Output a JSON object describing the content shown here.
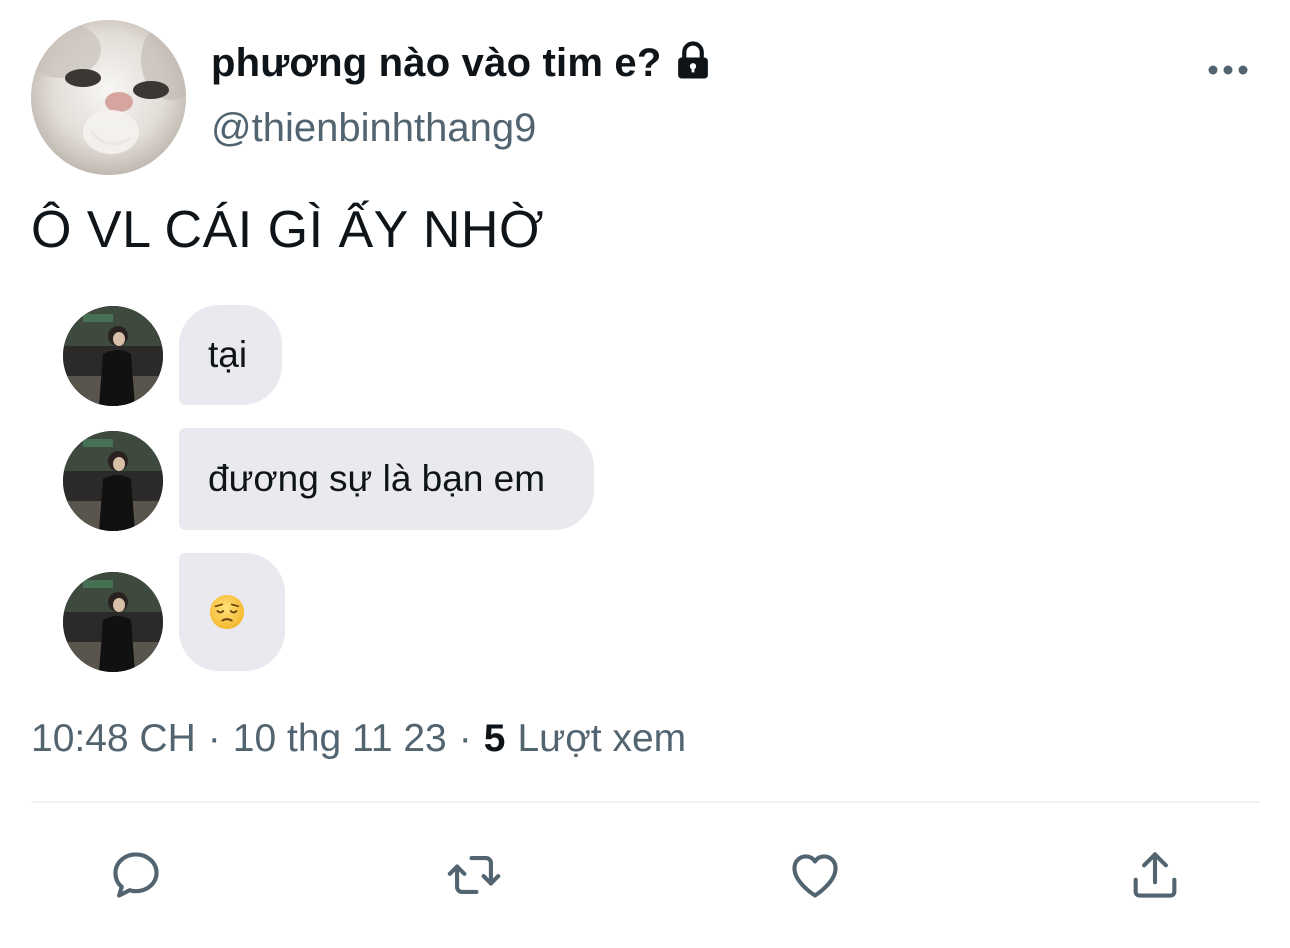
{
  "author": {
    "display_name": "phương nào vào tim e?",
    "handle": "@thienbinhthang9",
    "protected_icon": "lock-icon"
  },
  "tweet": {
    "text": "Ô VL CÁI GÌ ẤY NHỜ"
  },
  "chat_messages": [
    {
      "text": "tại"
    },
    {
      "text": "đương sự là bạn em"
    },
    {
      "text": "",
      "emoji": "pensive-face-emoji"
    }
  ],
  "meta": {
    "time": "10:48 CH",
    "separator": "·",
    "date": "10 thg 11 23",
    "views_count": "5",
    "views_label": "Lượt xem"
  },
  "actions": [
    "reply-icon",
    "retweet-icon",
    "like-icon",
    "share-icon"
  ],
  "colors": {
    "text_primary": "#0f1419",
    "text_secondary": "#536471",
    "bubble_bg": "#e9e9ef",
    "divider": "#eff3f4"
  }
}
